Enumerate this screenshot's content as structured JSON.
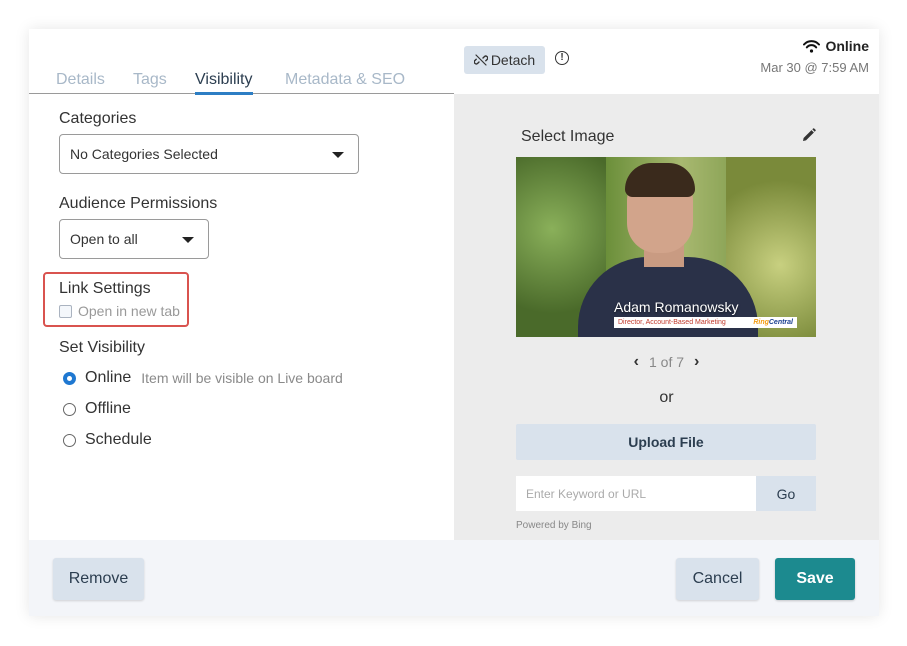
{
  "tabs": [
    {
      "label": "Details",
      "active": false
    },
    {
      "label": "Tags",
      "active": false
    },
    {
      "label": "Visibility",
      "active": true
    },
    {
      "label": "Metadata & SEO",
      "active": false
    }
  ],
  "header": {
    "detach_label": "Detach",
    "info_glyph": "!",
    "status_label": "Online",
    "timestamp": "Mar 30 @ 7:59 AM"
  },
  "categories": {
    "label": "Categories",
    "selected": "No Categories Selected"
  },
  "audience": {
    "label": "Audience Permissions",
    "selected": "Open to all"
  },
  "link_settings": {
    "label": "Link Settings",
    "open_new_tab_label": "Open in new tab",
    "open_new_tab_checked": false
  },
  "visibility": {
    "label": "Set Visibility",
    "options": [
      {
        "label": "Online",
        "hint": "Item will be visible on Live board",
        "checked": true
      },
      {
        "label": "Offline",
        "checked": false
      },
      {
        "label": "Schedule",
        "checked": false
      }
    ]
  },
  "image": {
    "label": "Select Image",
    "lower_third_name": "Adam Romanowsky",
    "lower_third_title": "Director, Account-Based Marketing",
    "lower_third_brand_a": "Ring",
    "lower_third_brand_b": "Central",
    "pager": "1 of 7",
    "or_text": "or",
    "upload_label": "Upload File",
    "search_placeholder": "Enter Keyword or URL",
    "go_label": "Go",
    "powered_by": "Powered by Bing"
  },
  "footer": {
    "remove_label": "Remove",
    "cancel_label": "Cancel",
    "save_label": "Save"
  },
  "colors": {
    "accent": "#2d7ec4",
    "save": "#1c8a8f",
    "highlight": "#d9534f",
    "button_bg": "#d9e2ec"
  },
  "icons": {
    "detach": "unlink-icon",
    "info": "info-circle-icon",
    "wifi": "wifi-icon",
    "pencil": "pencil-icon",
    "prev": "chevron-left-icon",
    "next": "chevron-right-icon",
    "caret": "caret-down-icon"
  }
}
